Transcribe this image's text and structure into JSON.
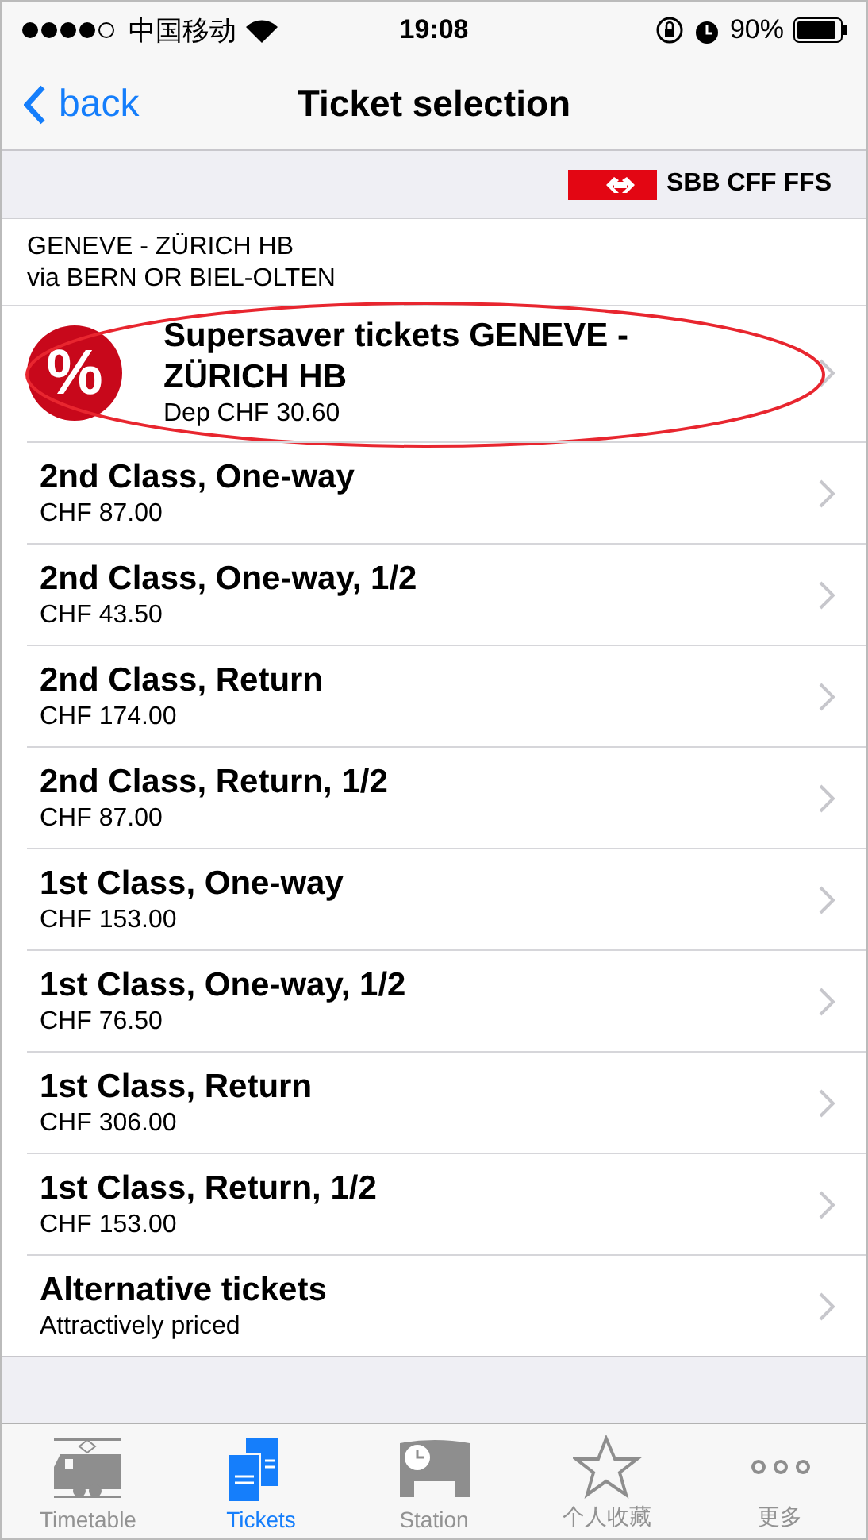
{
  "status_bar": {
    "carrier": "中国移动",
    "time": "19:08",
    "battery": "90%"
  },
  "nav": {
    "back": "back",
    "title": "Ticket selection"
  },
  "brand": {
    "name": "SBB CFF FFS"
  },
  "route": {
    "line_1": "GENEVE - ZÜRICH HB",
    "line_2": "via BERN OR BIEL-OLTEN"
  },
  "tickets": [
    {
      "kind": "offer",
      "badge": "%",
      "title": "Supersaver tickets GENEVE - ZÜRICH HB",
      "subtitle": "Dep CHF 30.60",
      "highlighted": true
    },
    {
      "kind": "plain",
      "title": "2nd Class, One-way",
      "subtitle": "CHF 87.00",
      "highlighted": false
    },
    {
      "kind": "plain",
      "title": "2nd Class, One-way, 1/2",
      "subtitle": "CHF 43.50",
      "highlighted": false
    },
    {
      "kind": "plain",
      "title": "2nd Class, Return",
      "subtitle": "CHF 174.00",
      "highlighted": false
    },
    {
      "kind": "plain",
      "title": "2nd Class, Return, 1/2",
      "subtitle": "CHF 87.00",
      "highlighted": false
    },
    {
      "kind": "plain",
      "title": "1st Class, One-way",
      "subtitle": "CHF 153.00",
      "highlighted": false
    },
    {
      "kind": "plain",
      "title": "1st Class, One-way, 1/2",
      "subtitle": "CHF 76.50",
      "highlighted": false
    },
    {
      "kind": "plain",
      "title": "1st Class, Return",
      "subtitle": "CHF 306.00",
      "highlighted": false
    },
    {
      "kind": "plain",
      "title": "1st Class, Return, 1/2",
      "subtitle": "CHF 153.00",
      "highlighted": false
    },
    {
      "kind": "plain",
      "title": "Alternative tickets",
      "subtitle": "Attractively priced",
      "highlighted": false
    }
  ],
  "tab_bar": [
    {
      "kind": "train",
      "label": "Timetable",
      "selected": false
    },
    {
      "kind": "tickets",
      "label": "Tickets",
      "selected": true
    },
    {
      "kind": "station",
      "label": "Station",
      "selected": false
    },
    {
      "kind": "star",
      "label": "个人收藏",
      "selected": false
    },
    {
      "kind": "more",
      "label": "更多",
      "selected": false
    }
  ]
}
